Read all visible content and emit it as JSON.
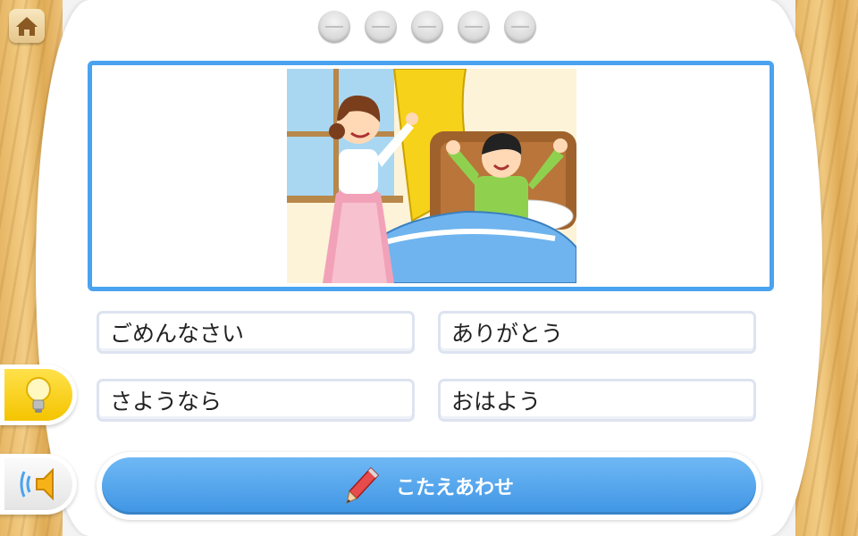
{
  "progress": {
    "total": 5,
    "completed": 0
  },
  "choices": [
    {
      "label": "ごめんなさい"
    },
    {
      "label": "ありがとう"
    },
    {
      "label": "さようなら"
    },
    {
      "label": "おはよう"
    }
  ],
  "answer_button": {
    "label": "こたえあわせ"
  },
  "icons": {
    "home": "home-icon",
    "hint": "lightbulb-icon",
    "sound": "speaker-icon",
    "answer": "pencil-icon"
  },
  "colors": {
    "accent_blue": "#4aa3f0",
    "hint_yellow": "#f4c400",
    "wood": "#e6b765"
  }
}
